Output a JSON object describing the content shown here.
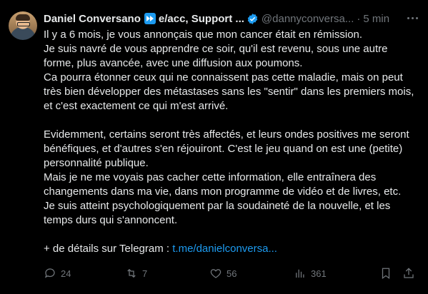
{
  "author": {
    "name": "Daniel Conversano",
    "name_suffix": "e/acc, Support ...",
    "handle": "@dannyconversa...",
    "time": "5 min"
  },
  "body": {
    "lines_p1": [
      "Il y a 6 mois, je vous annonçais que mon cancer était en rémission.",
      "Je suis navré de vous apprendre ce soir, qu'il est revenu, sous une autre forme, plus avancée, avec une diffusion aux poumons.",
      "Ca pourra étonner ceux qui ne connaissent pas cette maladie, mais on peut très bien développer des métastases sans les \"sentir\" dans les premiers mois, et c'est exactement ce qui m'est arrivé."
    ],
    "lines_p2": [
      "Evidemment, certains seront très affectés, et leurs ondes positives me seront bénéfiques, et d'autres s'en réjouiront. C'est le jeu quand on est une (petite) personnalité publique.",
      "Mais je ne me voyais pas cacher cette information, elle entraînera des changements dans ma vie, dans mon programme de vidéo et de livres, etc.",
      "Je suis atteint psychologiquement par la soudaineté de la nouvelle, et les temps durs qui s'annoncent."
    ],
    "telegram_prefix": "+ de détails sur Telegram : ",
    "telegram_link": "t.me/danielconversa..."
  },
  "actions": {
    "replies": "24",
    "retweets": "7",
    "likes": "56",
    "views": "361"
  },
  "colors": {
    "background": "#000000",
    "text": "#e7e9ea",
    "muted": "#71767b",
    "accent": "#1d9bf0"
  },
  "icons": [
    "avatar",
    "fast-forward-badge-icon",
    "verified-icon",
    "more-icon",
    "reply-icon",
    "retweet-icon",
    "like-icon",
    "views-icon",
    "bookmark-icon",
    "share-icon"
  ]
}
